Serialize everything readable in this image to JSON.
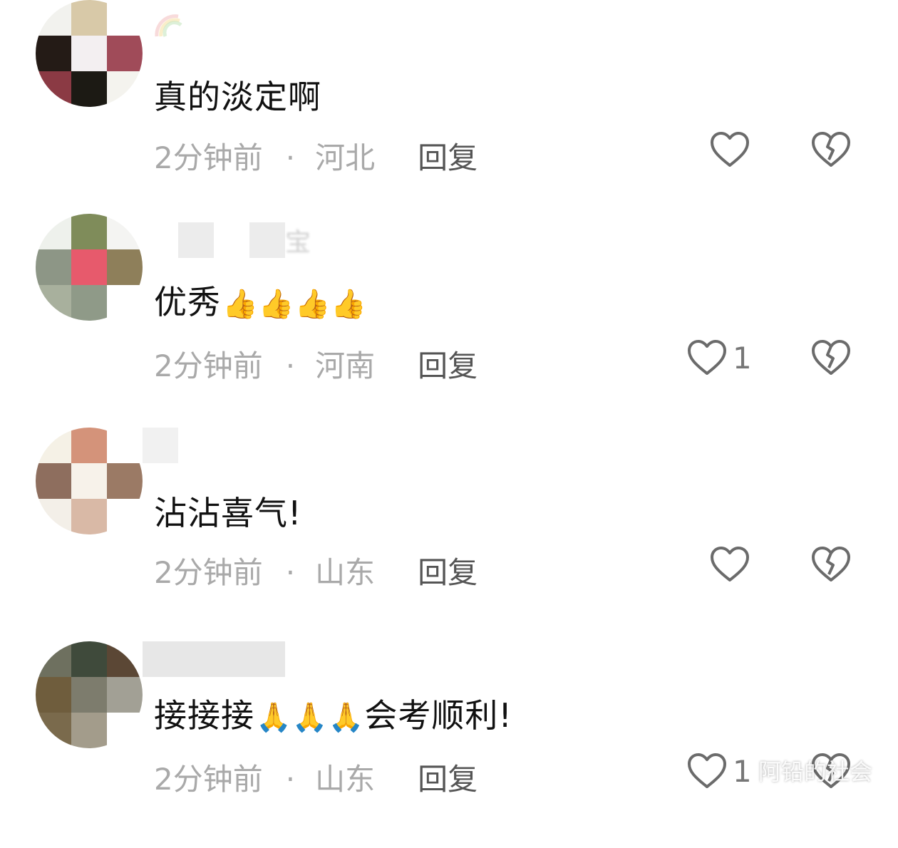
{
  "comments": [
    {
      "name_visible": "",
      "text": "真的淡定啊",
      "emoji": "",
      "time": "2分钟前",
      "location": "河北",
      "reply": "回复",
      "likes": "",
      "avatar_colors": [
        "#f2f2ee",
        "#d8c9a8",
        "#ffffff",
        "#241b16",
        "#f3eff1",
        "#a04b59",
        "#8b3a44",
        "#1c1a14",
        "#f4f3ee"
      ]
    },
    {
      "name_visible": "宝",
      "text": "优秀",
      "emoji": "👍👍👍👍",
      "time": "2分钟前",
      "location": "河南",
      "reply": "回复",
      "likes": "1",
      "avatar_colors": [
        "#eef1ec",
        "#7f8c5a",
        "#f4f4f2",
        "#8d9686",
        "#e75a6c",
        "#8e7f5a",
        "#a8b09d",
        "#8f9a88",
        "#ffffff"
      ]
    },
    {
      "name_visible": "",
      "text": "沾沾喜气!",
      "emoji": "",
      "time": "2分钟前",
      "location": "山东",
      "reply": "回复",
      "likes": "",
      "avatar_colors": [
        "#f5f1e6",
        "#d4937a",
        "#ffffff",
        "#8e6e5e",
        "#f7f2ea",
        "#9b7a65",
        "#f3efe8",
        "#d9b9a6",
        "#ffffff"
      ]
    },
    {
      "name_visible": "",
      "text": "接接接",
      "emoji": "🙏🙏🙏",
      "text_after": "会考顺利!",
      "time": "2分钟前",
      "location": "山东",
      "reply": "回复",
      "likes": "1",
      "avatar_colors": [
        "#6e705f",
        "#3f4a3b",
        "#5b4735",
        "#6f5d3d",
        "#7d7c6d",
        "#a2a095",
        "#7a6a4c",
        "#a39c8b",
        "#ffffff"
      ]
    }
  ],
  "watermark": "阿铅的社会"
}
